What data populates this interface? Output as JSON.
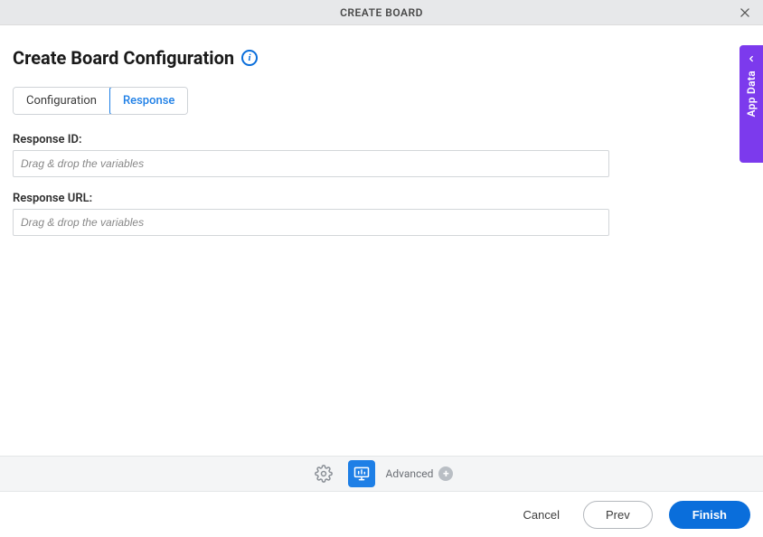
{
  "header": {
    "title": "CREATE BOARD"
  },
  "page": {
    "title": "Create Board Configuration"
  },
  "tabs": {
    "configuration": "Configuration",
    "response": "Response"
  },
  "fields": {
    "response_id": {
      "label": "Response ID:",
      "placeholder": "Drag & drop the variables",
      "value": ""
    },
    "response_url": {
      "label": "Response URL:",
      "placeholder": "Drag & drop the variables",
      "value": ""
    }
  },
  "sidebar": {
    "app_data": "App Data"
  },
  "toolbar": {
    "advanced": "Advanced"
  },
  "footer": {
    "cancel": "Cancel",
    "prev": "Prev",
    "finish": "Finish"
  },
  "colors": {
    "primary": "#0a6edb",
    "purple": "#7c3aed"
  }
}
